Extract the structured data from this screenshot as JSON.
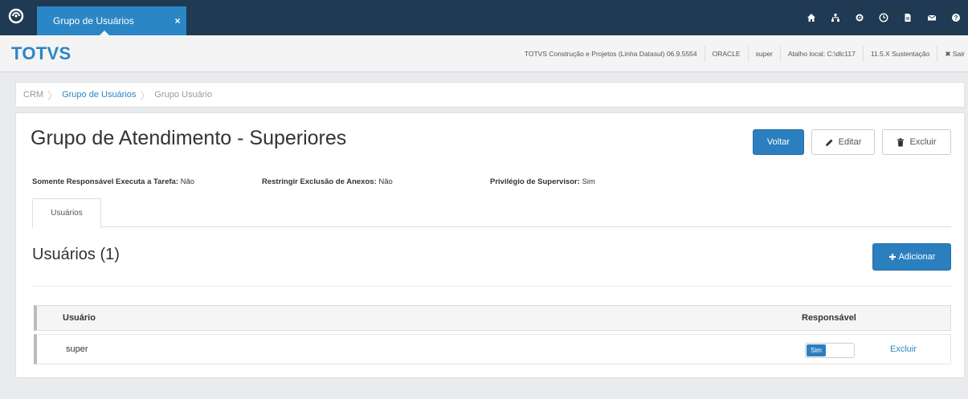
{
  "topbar": {
    "tab_label": "Grupo de Usuários",
    "tab_close": "×",
    "icons": [
      "home-icon",
      "sitemap-icon",
      "gear-icon",
      "clock-icon",
      "document-icon",
      "mail-icon",
      "help-icon"
    ]
  },
  "subbar": {
    "brand": "TOTVS",
    "items": [
      "TOTVS Construção e Projetos (Linha Datasul) 06.9.5554",
      "ORACLE",
      "super",
      "Atalho local: C:\\dlc117",
      "11.5.X Sustentação"
    ],
    "logout_label": "✖ Sair"
  },
  "breadcrumb": {
    "items": [
      "CRM",
      "Grupo de Usuários",
      "Grupo Usuário"
    ]
  },
  "page": {
    "title": "Grupo de Atendimento - Superiores",
    "btn_back": "Voltar",
    "btn_edit": "Editar",
    "btn_delete": "Excluir"
  },
  "fields": [
    {
      "label": "Somente Responsável Executa a Tarefa:",
      "value": "Não"
    },
    {
      "label": "Restringir Exclusão de Anexos:",
      "value": "Não"
    },
    {
      "label": "Privilégio de Supervisor:",
      "value": "Sim"
    }
  ],
  "tabs": [
    "Usuários"
  ],
  "section": {
    "title": "Usuários (1)",
    "add_label": "Adicionar"
  },
  "table": {
    "columns": [
      "Usuário",
      "Responsável"
    ],
    "rows": [
      {
        "user": "super",
        "toggle_label": "Sim",
        "toggle_on": true,
        "action": "Excluir"
      }
    ]
  },
  "colors": {
    "topbar": "#1f3a52",
    "accent": "#2b86c5",
    "primary_button": "#2b7fbf"
  }
}
